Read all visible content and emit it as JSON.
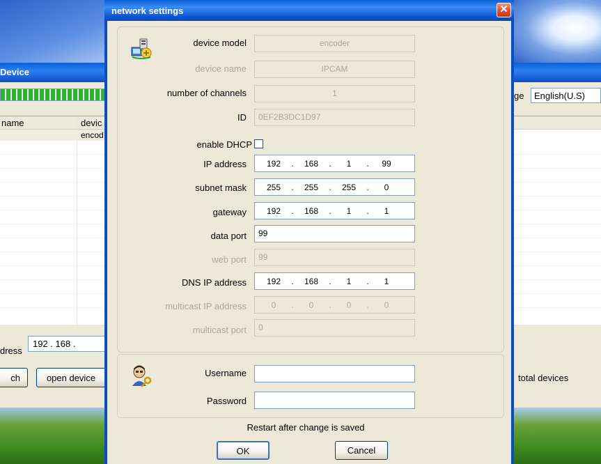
{
  "background_app": {
    "title": "Device",
    "language_label": "ge",
    "language_value": "English(U.S)",
    "list_headers": [
      "name",
      "devic"
    ],
    "list_rows": [
      [
        "",
        "encod"
      ]
    ],
    "address_label": "dress",
    "address_value": "192 . 168 .",
    "search_button": "ch",
    "open_device_button": "open device",
    "total_devices_label": "total devices"
  },
  "dialog": {
    "title": "network settings",
    "fields": {
      "device_model": {
        "label": "device model",
        "value": "encoder"
      },
      "device_name": {
        "label": "device name",
        "value": "IPCAM"
      },
      "number_of_channels": {
        "label": "number of channels",
        "value": "1"
      },
      "id": {
        "label": "ID",
        "value": "0EF2B3DC1D97"
      },
      "enable_dhcp": {
        "label": "enable DHCP",
        "checked": false
      },
      "ip_address": {
        "label": "IP address",
        "octets": [
          "192",
          "168",
          "1",
          "99"
        ]
      },
      "subnet_mask": {
        "label": "subnet mask",
        "octets": [
          "255",
          "255",
          "255",
          "0"
        ]
      },
      "gateway": {
        "label": "gateway",
        "octets": [
          "192",
          "168",
          "1",
          "1"
        ]
      },
      "data_port": {
        "label": "data port",
        "value": "99"
      },
      "web_port": {
        "label": "web port",
        "value": "99"
      },
      "dns_ip_address": {
        "label": "DNS IP address",
        "octets": [
          "192",
          "168",
          "1",
          "1"
        ]
      },
      "multicast_ip_address": {
        "label": "multicast IP address",
        "octets": [
          "0",
          "0",
          "0",
          "0"
        ]
      },
      "multicast_port": {
        "label": "multicast port",
        "value": "0"
      }
    },
    "credentials": {
      "username_label": "Username",
      "username_value": "",
      "password_label": "Password",
      "password_value": ""
    },
    "restart_note": "Restart after change is saved",
    "ok_button": "OK",
    "cancel_button": "Cancel",
    "icons": {
      "close": "close-icon",
      "device": "network-device-icon",
      "user": "user-key-icon"
    }
  }
}
